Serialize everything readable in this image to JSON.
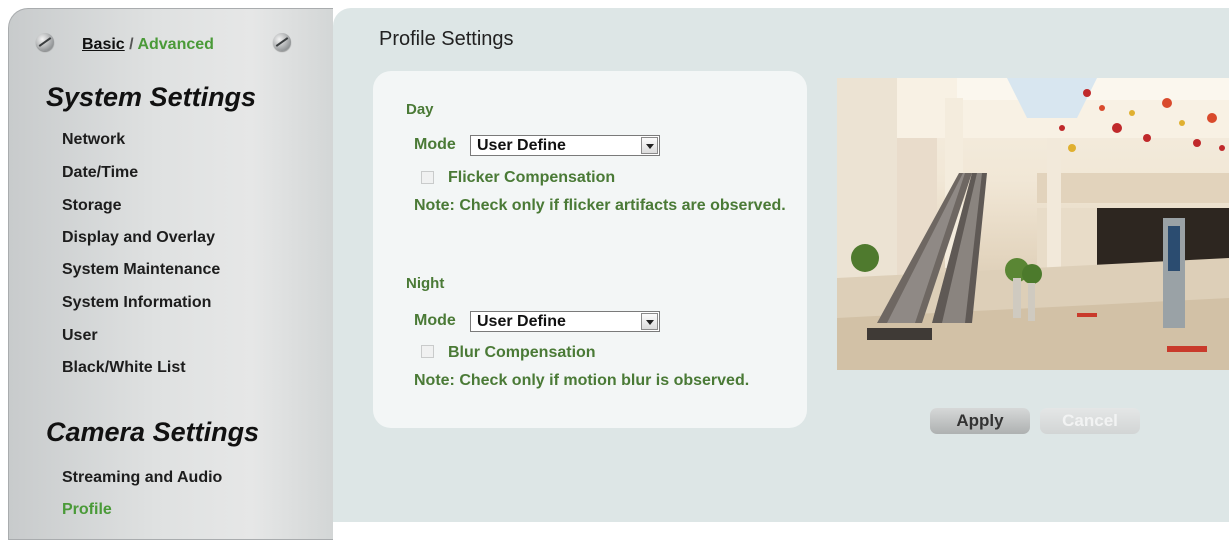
{
  "mode_switch": {
    "basic": "Basic",
    "separator": " / ",
    "advanced": "Advanced"
  },
  "sidebar": {
    "system_title": "System Settings",
    "system_items": [
      {
        "label": "Network"
      },
      {
        "label": "Date/Time"
      },
      {
        "label": "Storage"
      },
      {
        "label": "Display and Overlay"
      },
      {
        "label": "System Maintenance"
      },
      {
        "label": "System Information"
      },
      {
        "label": "User"
      },
      {
        "label": "Black/White List"
      }
    ],
    "camera_title": "Camera Settings",
    "camera_items": [
      {
        "label": "Streaming and Audio"
      },
      {
        "label": "Profile",
        "active": true
      }
    ]
  },
  "main": {
    "title": "Profile Settings",
    "day": {
      "title": "Day",
      "mode_label": "Mode",
      "mode_value": "User Define",
      "checkbox_label": "Flicker Compensation",
      "checkbox_checked": false,
      "note": "Note: Check only if flicker artifacts are observed."
    },
    "night": {
      "title": "Night",
      "mode_label": "Mode",
      "mode_value": "User Define",
      "checkbox_label": "Blur Compensation",
      "checkbox_checked": false,
      "note": "Note: Check only if motion blur is observed."
    },
    "apply_label": "Apply",
    "cancel_label": "Cancel"
  },
  "colors": {
    "accent_green": "#4a9a38",
    "label_green": "#4a7a36",
    "main_bg": "#dde6e6",
    "panel_bg": "#f3f6f6"
  }
}
